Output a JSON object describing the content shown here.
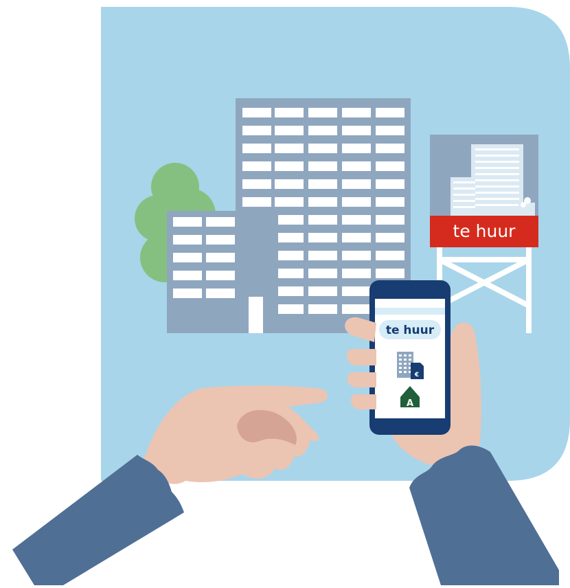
{
  "sign": {
    "label": "te huur"
  },
  "phone": {
    "badge_label": "te huur",
    "currency_symbol": "€",
    "energy_label": "A"
  },
  "colors": {
    "background": "#a8d5ea",
    "building": "#8fa6bf",
    "window": "#ffffff",
    "tree": "#86c080",
    "sign_red": "#d52b1e",
    "phone_body": "#173d72",
    "phone_badge": "#d6ecf7",
    "energy_house": "#1f5f3a",
    "skin": "#ecc4b2",
    "skin_shadow": "#d6a494",
    "sleeve": "#4f6f95"
  }
}
